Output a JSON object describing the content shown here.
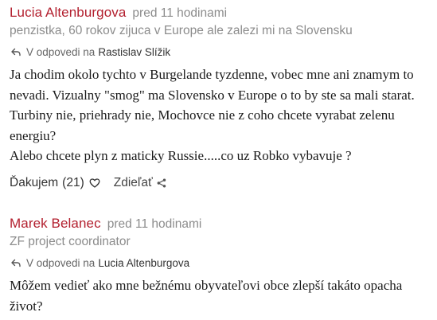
{
  "comments": [
    {
      "author": "Lucia Altenburgova",
      "time": "pred 11 hodinami",
      "bio": "penzistka, 60 rokov zijuca v Europe ale zalezi mi na Slovensku",
      "reply_prefix": "V odpovedi na",
      "reply_to": "Rastislav Slížik",
      "body": [
        "Ja chodim okolo tychto v Burgelande tyzdenne, vobec mne ani znamym to nevadi. Vizualny \"smog\" ma Slovensko v Europe o to by ste sa mali starat. Turbiny nie, priehrady nie, Mochovce nie z coho chcete vyrabat zelenu energiu?",
        "Alebo chcete plyn z maticky Russie.....co uz Robko vybavuje ?"
      ],
      "like_label": "Ďakujem",
      "like_count": "(21)",
      "share_label": "Zdieľať"
    },
    {
      "author": "Marek Belanec",
      "time": "pred 11 hodinami",
      "bio": "ZF project coordinator",
      "reply_prefix": "V odpovedi na",
      "reply_to": "Lucia Altenburgova",
      "body": [
        "Môžem vedieť ako mne bežnému obyvateľovi obce zlepší takáto opacha život?"
      ]
    }
  ],
  "colors": {
    "author": "#b3202f",
    "meta": "#8c8c8c",
    "text": "#1a1a1a"
  },
  "icons": {
    "reply": "reply-arrow-icon",
    "like": "heart-outline-icon",
    "share": "share-icon"
  }
}
